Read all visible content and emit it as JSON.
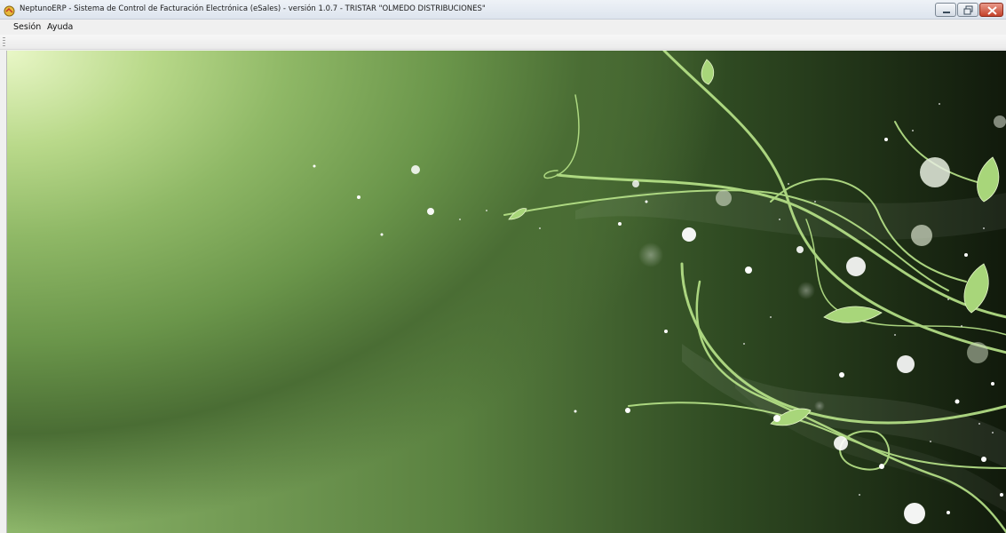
{
  "window": {
    "title": "NeptunoERP - Sistema de Control de Facturación Electrónica (eSales) - versión 1.0.7 - TRISTAR \"OLMEDO DISTRIBUCIONES\""
  },
  "menu": {
    "items": [
      {
        "label": "Sesión"
      },
      {
        "label": "Ayuda"
      }
    ]
  },
  "colors": {
    "close_button": "#c4422b",
    "background_light": "#e9f7c7",
    "background_dark": "#111a0c",
    "vine": "#b9e58a"
  },
  "icons": {
    "app": "app-icon",
    "minimize": "minimize-icon",
    "maximize": "maximize-icon",
    "close": "close-icon"
  }
}
